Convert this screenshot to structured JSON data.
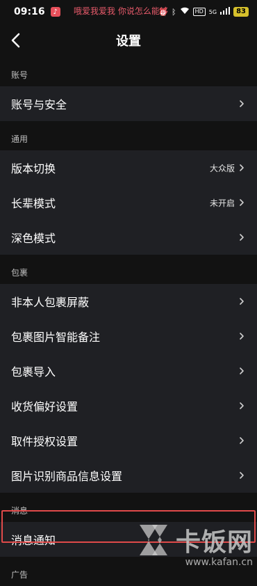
{
  "status": {
    "time": "09:16",
    "notice": "哦爱我爱我 你说怎么能够",
    "hd": "HD",
    "net": "5G",
    "battery": "83"
  },
  "header": {
    "title": "设置"
  },
  "sections": [
    {
      "label": "账号",
      "items": [
        {
          "label": "账号与安全"
        }
      ]
    },
    {
      "label": "通用",
      "items": [
        {
          "label": "版本切换",
          "value": "大众版"
        },
        {
          "label": "长辈模式",
          "value": "未开启"
        },
        {
          "label": "深色模式"
        }
      ]
    },
    {
      "label": "包裹",
      "items": [
        {
          "label": "非本人包裹屏蔽"
        },
        {
          "label": "包裹图片智能备注"
        },
        {
          "label": "包裹导入"
        },
        {
          "label": "收货偏好设置"
        },
        {
          "label": "取件授权设置"
        },
        {
          "label": "图片识别商品信息设置"
        }
      ]
    },
    {
      "label": "消息",
      "items": [
        {
          "label": "消息通知"
        }
      ]
    },
    {
      "label": "广告",
      "items": []
    }
  ],
  "watermark": {
    "brand": "卡饭网",
    "url": "www.kafan.cn"
  },
  "colors": {
    "background": "#121212",
    "row": "#1f2024",
    "highlight": "#e04a4a"
  },
  "icons": {
    "back": "chevron-left-icon",
    "row_arrow": "chevron-right-icon"
  }
}
